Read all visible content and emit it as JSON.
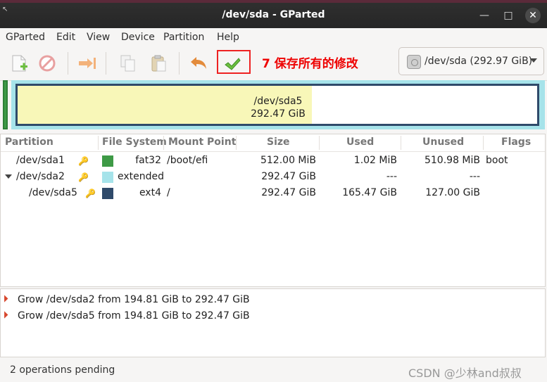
{
  "window": {
    "title": "/dev/sda - GParted",
    "minimize_glyph": "—",
    "maximize_glyph": "□",
    "close_glyph": "✕"
  },
  "menu": {
    "items": [
      "GParted",
      "Edit",
      "View",
      "Device",
      "Partition",
      "Help"
    ]
  },
  "toolbar": {
    "annotation": "7 保存所有的修改",
    "icons": [
      "new-partition-icon",
      "delete-icon",
      "resize-move-icon",
      "copy-icon",
      "paste-icon",
      "undo-icon",
      "apply-icon"
    ],
    "device_selector": {
      "value": "/dev/sda (292.97 GiB)",
      "icon": "harddisk-icon"
    }
  },
  "partition_map": {
    "label": "/dev/sda5",
    "size": "292.47 GiB",
    "colors": {
      "fat32": "#3e9a46",
      "extended": "#a6e3ea",
      "ext4": "#2f4a6a",
      "used": "#f8f7b8"
    }
  },
  "table": {
    "headers": [
      "Partition",
      "File System",
      "Mount Point",
      "Size",
      "Used",
      "Unused",
      "Flags"
    ],
    "rows": [
      {
        "partition": "/dev/sda1",
        "filesystem": "fat32",
        "mount": "/boot/efi",
        "size": "512.00 MiB",
        "used": "1.02 MiB",
        "unused": "510.98 MiB",
        "flags": "boot",
        "color": "#3e9a46"
      },
      {
        "partition": "/dev/sda2",
        "filesystem": "extended",
        "mount": "",
        "size": "292.47 GiB",
        "used": "---",
        "unused": "---",
        "flags": "",
        "color": "#a6e3ea"
      },
      {
        "partition": "/dev/sda5",
        "filesystem": "ext4",
        "mount": "/",
        "size": "292.47 GiB",
        "used": "165.47 GiB",
        "unused": "127.00 GiB",
        "flags": "",
        "color": "#2f4a6a"
      }
    ]
  },
  "operations": [
    "Grow /dev/sda2 from 194.81 GiB to 292.47 GiB",
    "Grow /dev/sda5 from 194.81 GiB to 292.47 GiB"
  ],
  "status": {
    "text": "2 operations pending",
    "watermark": "CSDN @少林and叔叔"
  }
}
